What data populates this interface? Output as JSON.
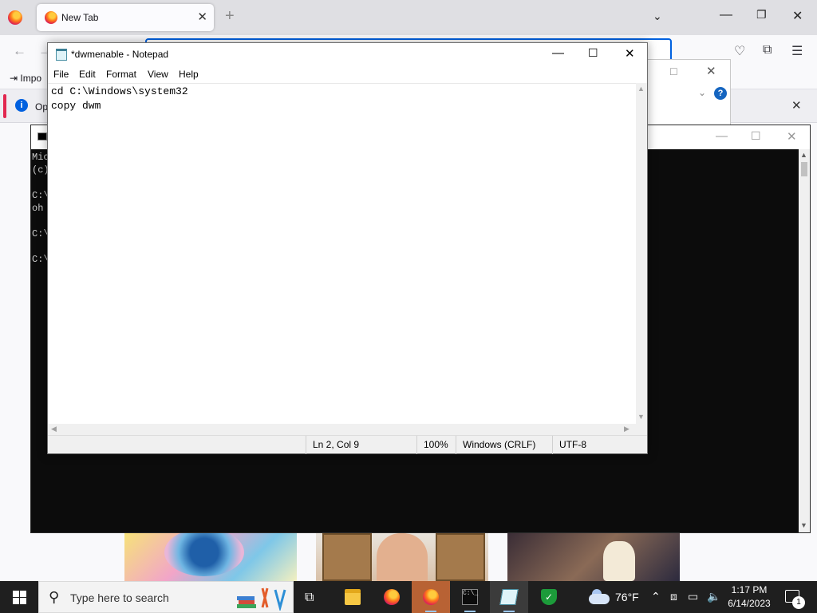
{
  "firefox": {
    "tab_title": "New Tab",
    "bookmark_label": "Impo",
    "info_text": "Op"
  },
  "cmd": {
    "lines": [
      "Mic",
      "(c)",
      "",
      "C:\\",
      "oh ",
      "",
      "C:\\",
      "",
      "C:\\"
    ]
  },
  "notepad": {
    "title": "*dwmenable - Notepad",
    "menu": [
      "File",
      "Edit",
      "Format",
      "View",
      "Help"
    ],
    "content": "cd C:\\Windows\\system32\ncopy dwm",
    "status": {
      "position": "Ln 2, Col 9",
      "zoom": "100%",
      "line_ending": "Windows (CRLF)",
      "encoding": "UTF-8"
    }
  },
  "taskbar": {
    "search_placeholder": "Type here to search",
    "weather": "76°F",
    "time": "1:17 PM",
    "date": "6/14/2023",
    "notification_count": "1",
    "apps": [
      "task-view",
      "file-explorer",
      "firefox",
      "firefox",
      "command-prompt",
      "notepad",
      "security"
    ]
  },
  "colors": {
    "accent": "#0061e0",
    "taskbar": "#1f1f1f",
    "console_bg": "#0c0c0c",
    "active_firefox": "#b86234"
  }
}
